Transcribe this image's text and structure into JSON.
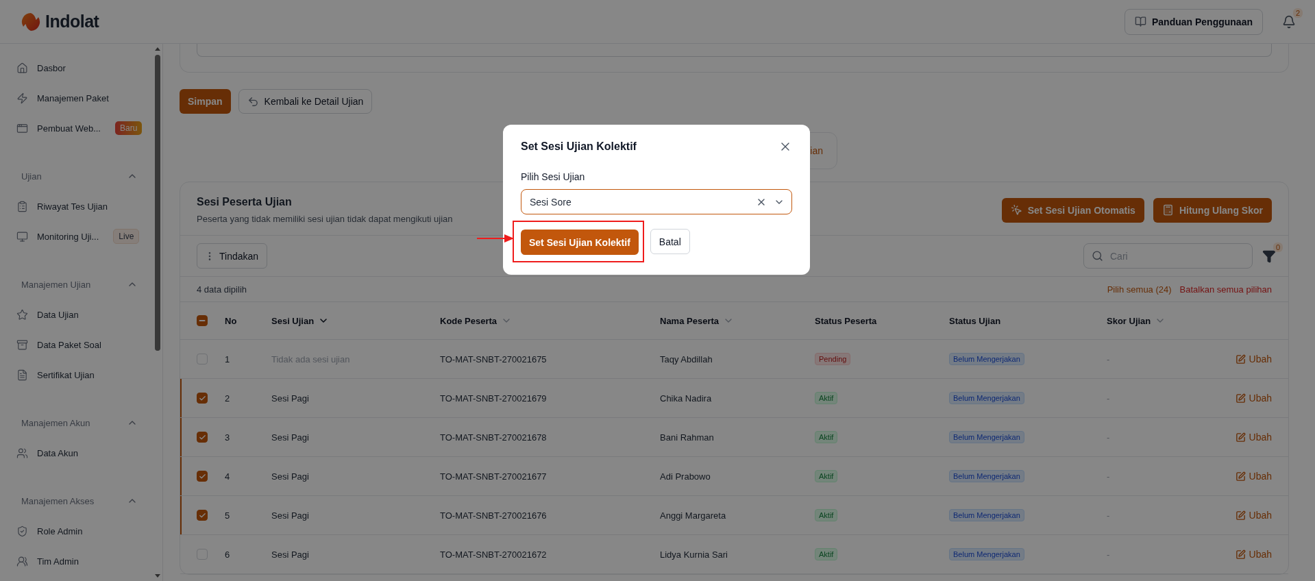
{
  "brand": {
    "name": "Indolat"
  },
  "header": {
    "guide_button": "Panduan Penggunaan",
    "notification_count": "2"
  },
  "sidebar": {
    "sections": [
      {
        "items": [
          {
            "label": "Dasbor"
          },
          {
            "label": "Manajemen Paket"
          },
          {
            "label": "Pembuat Web...",
            "badge": {
              "text": "Baru",
              "kind": "new"
            }
          }
        ]
      },
      {
        "title": "Ujian",
        "expanded": true,
        "items": [
          {
            "label": "Riwayat Tes Ujian"
          },
          {
            "label": "Monitoring Uji...",
            "badge": {
              "text": "Live",
              "kind": "live"
            }
          }
        ]
      },
      {
        "title": "Manajemen Ujian",
        "expanded": true,
        "items": [
          {
            "label": "Data Ujian"
          },
          {
            "label": "Data Paket Soal"
          },
          {
            "label": "Sertifikat Ujian"
          }
        ]
      },
      {
        "title": "Manajemen Akun",
        "expanded": true,
        "items": [
          {
            "label": "Data Akun"
          }
        ]
      },
      {
        "title": "Manajemen Akses",
        "expanded": true,
        "items": [
          {
            "label": "Role Admin"
          },
          {
            "label": "Tim Admin"
          }
        ]
      }
    ]
  },
  "form_actions": {
    "save": "Simpan",
    "back": "Kembali ke Detail Ujian"
  },
  "covered_button": {
    "label": "ian"
  },
  "panel": {
    "title": "Sesi Peserta Ujian",
    "subtitle": "Peserta yang tidak memiliki sesi ujian tidak dapat mengikuti ujian",
    "actions": [
      {
        "label": "Set Sesi Ujian Otomatis",
        "kind": "auto"
      },
      {
        "label": "Hitung Ulang Skor",
        "kind": "recount"
      }
    ],
    "toolbar": {
      "action_menu": "Tindakan",
      "search": {
        "placeholder": "Cari"
      },
      "filter_count": "0"
    },
    "selection": {
      "summary": "4 data dipilih",
      "select_all": "Pilih semua (24)",
      "clear": "Batalkan semua pilihan"
    },
    "table": {
      "all_checkbox": {
        "indeterminate": true
      },
      "columns": [
        {
          "label": "No",
          "sortable": false
        },
        {
          "label": "Sesi Ujian",
          "sortable": true,
          "sorted": true
        },
        {
          "label": "Kode Peserta",
          "sortable": true,
          "sorted": false
        },
        {
          "label": "Nama Peserta",
          "sortable": true,
          "sorted": false
        },
        {
          "label": "Status Peserta",
          "sortable": false
        },
        {
          "label": "Status Ujian",
          "sortable": false
        },
        {
          "label": "Skor Ujian",
          "sortable": true,
          "sorted": false
        }
      ],
      "rows": [
        {
          "selected": false,
          "no": "1",
          "session": "Tidak ada sesi ujian",
          "session_empty": true,
          "code": "TO-MAT-SNBT-270021675",
          "name": "Taqy Abdillah",
          "participant_status": {
            "text": "Pending",
            "kind": "pending"
          },
          "exam_status": {
            "text": "Belum Mengerjakan",
            "kind": "not_started"
          },
          "score": "-",
          "action": "Ubah"
        },
        {
          "selected": true,
          "no": "2",
          "session": "Sesi Pagi",
          "session_empty": false,
          "code": "TO-MAT-SNBT-270021679",
          "name": "Chika Nadira",
          "participant_status": {
            "text": "Aktif",
            "kind": "active"
          },
          "exam_status": {
            "text": "Belum Mengerjakan",
            "kind": "not_started"
          },
          "score": "-",
          "action": "Ubah"
        },
        {
          "selected": true,
          "no": "3",
          "session": "Sesi Pagi",
          "session_empty": false,
          "code": "TO-MAT-SNBT-270021678",
          "name": "Bani Rahman",
          "participant_status": {
            "text": "Aktif",
            "kind": "active"
          },
          "exam_status": {
            "text": "Belum Mengerjakan",
            "kind": "not_started"
          },
          "score": "-",
          "action": "Ubah"
        },
        {
          "selected": true,
          "no": "4",
          "session": "Sesi Pagi",
          "session_empty": false,
          "code": "TO-MAT-SNBT-270021677",
          "name": "Adi Prabowo",
          "participant_status": {
            "text": "Aktif",
            "kind": "active"
          },
          "exam_status": {
            "text": "Belum Mengerjakan",
            "kind": "not_started"
          },
          "score": "-",
          "action": "Ubah"
        },
        {
          "selected": true,
          "no": "5",
          "session": "Sesi Pagi",
          "session_empty": false,
          "code": "TO-MAT-SNBT-270021676",
          "name": "Anggi Margareta",
          "participant_status": {
            "text": "Aktif",
            "kind": "active"
          },
          "exam_status": {
            "text": "Belum Mengerjakan",
            "kind": "not_started"
          },
          "score": "-",
          "action": "Ubah"
        },
        {
          "selected": false,
          "no": "6",
          "session": "Sesi Pagi",
          "session_empty": false,
          "code": "TO-MAT-SNBT-270021672",
          "name": "Lidya Kurnia Sari",
          "participant_status": {
            "text": "Aktif",
            "kind": "active"
          },
          "exam_status": {
            "text": "Belum Mengerjakan",
            "kind": "not_started"
          },
          "score": "-",
          "action": "Ubah"
        }
      ]
    }
  },
  "modal": {
    "title": "Set Sesi Ujian Kolektif",
    "field_label": "Pilih Sesi Ujian",
    "select": {
      "value": "Sesi Sore"
    },
    "confirm": "Set Sesi Ujian Kolektif",
    "cancel": "Batal",
    "highlight": true
  }
}
